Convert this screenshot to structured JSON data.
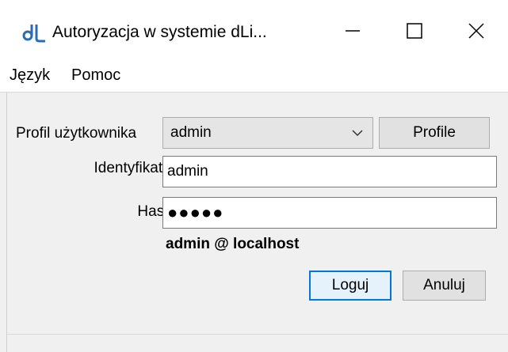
{
  "window": {
    "title": "Autoryzacja w systemie dLi...",
    "minimize_icon": "minimize-icon",
    "maximize_icon": "maximize-icon",
    "close_icon": "close-icon"
  },
  "menu": {
    "items": [
      {
        "label": "Język"
      },
      {
        "label": "Pomoc"
      }
    ]
  },
  "form": {
    "profile_label": "Profil użytkownika",
    "profile_value": "admin",
    "profile_button": "Profile",
    "identifier_label": "Identyfikator",
    "identifier_value": "admin",
    "password_label": "Hasło",
    "password_mask": "●●●●●",
    "status_text": "admin @ localhost",
    "login_button": "Loguj",
    "cancel_button": "Anuluj"
  },
  "colors": {
    "accent": "#0078d7",
    "window_bg": "#f0f0f0",
    "titlebar_bg": "#ffffff"
  }
}
